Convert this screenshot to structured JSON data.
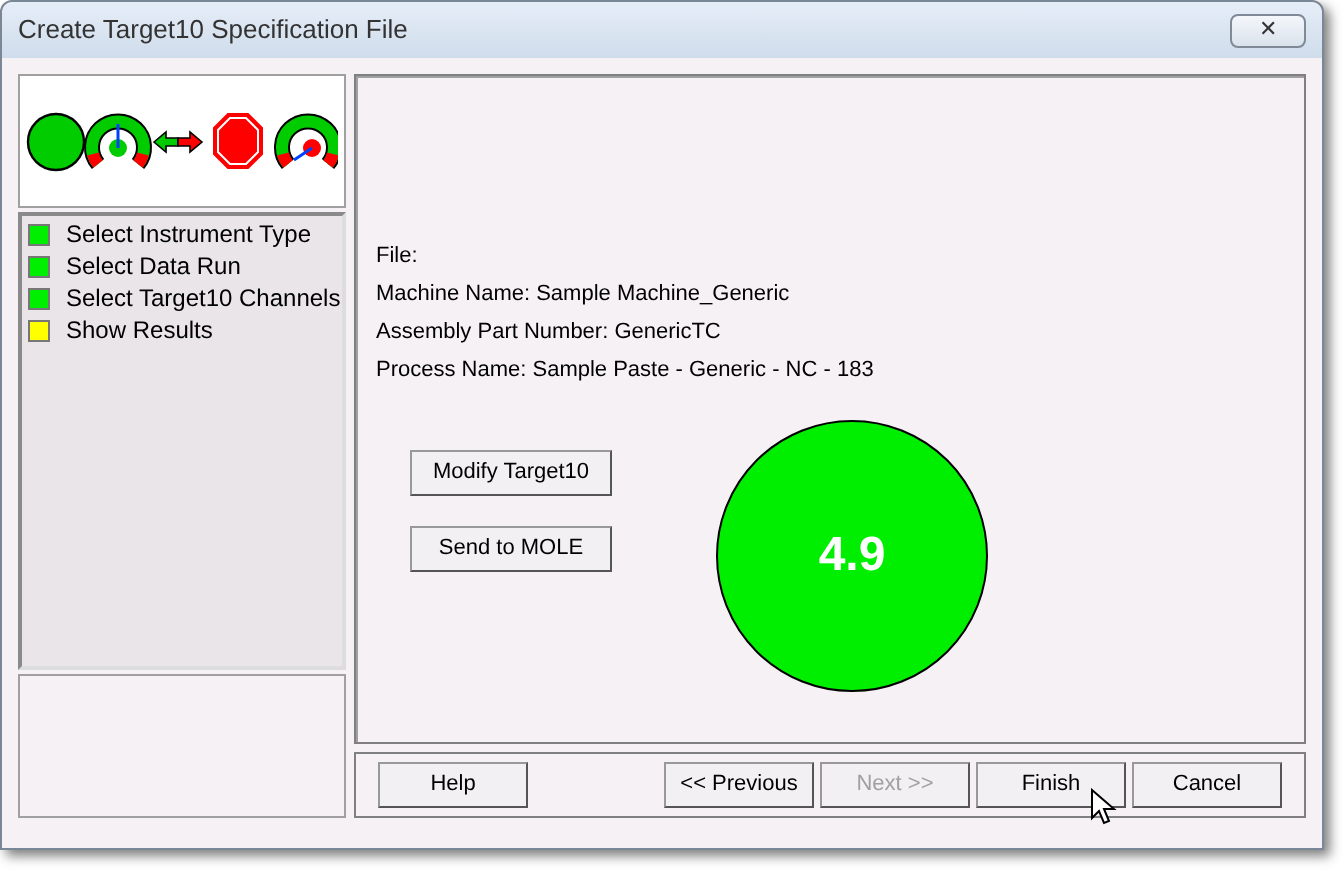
{
  "window": {
    "title": "Create Target10 Specification File",
    "close": "✕"
  },
  "steps": [
    {
      "label": "Select Instrument Type",
      "color": "#00ee00"
    },
    {
      "label": "Select Data Run",
      "color": "#00ee00"
    },
    {
      "label": "Select Target10 Channels",
      "color": "#00ee00"
    },
    {
      "label": "Show Results",
      "color": "#ffff00"
    }
  ],
  "info": [
    "File:",
    "Machine Name: Sample Machine_Generic",
    "Assembly Part Number: GenericTC",
    "Process Name: Sample Paste - Generic - NC - 183"
  ],
  "actions": [
    "Modify Target10",
    "Send to MOLE"
  ],
  "result": {
    "value": "4.9",
    "color": "#00ee00"
  },
  "footer": [
    {
      "label": "Help",
      "disabled": false,
      "kind": "left"
    },
    {
      "label": "<< Previous",
      "disabled": false,
      "kind": "right"
    },
    {
      "label": "Next >>",
      "disabled": true,
      "kind": "right"
    },
    {
      "label": "Finish",
      "disabled": false,
      "kind": "right"
    },
    {
      "label": "Cancel",
      "disabled": false,
      "kind": "right"
    }
  ]
}
